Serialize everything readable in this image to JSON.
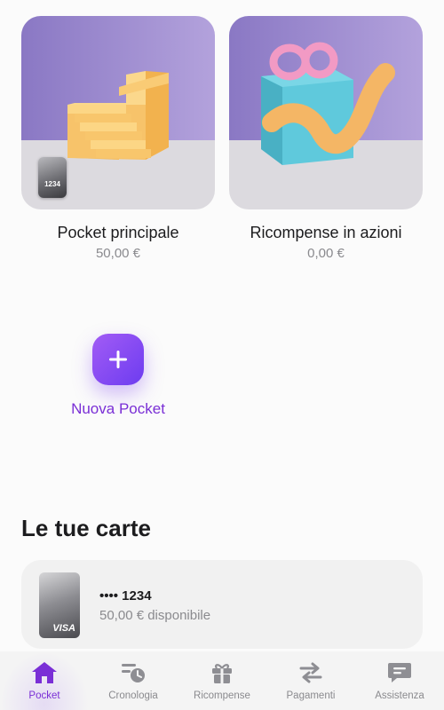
{
  "pockets": [
    {
      "name": "Pocket principale",
      "amount": "50,00 €",
      "card_last4": "1234"
    },
    {
      "name": "Ricompense in azioni",
      "amount": "0,00 €"
    }
  ],
  "new_pocket": {
    "label": "Nuova Pocket"
  },
  "cards_section": {
    "title": "Le tue carte",
    "card": {
      "number": "•••• 1234",
      "available": "50,00 € disponibile",
      "brand": "VISA"
    }
  },
  "tabs": [
    {
      "label": "Pocket",
      "icon": "home-icon",
      "active": true
    },
    {
      "label": "Cronologia",
      "icon": "history-icon",
      "active": false
    },
    {
      "label": "Ricompense",
      "icon": "gift-icon",
      "active": false
    },
    {
      "label": "Pagamenti",
      "icon": "transfer-arrows-icon",
      "active": false
    },
    {
      "label": "Assistenza",
      "icon": "chat-icon",
      "active": false
    }
  ],
  "colors": {
    "accent": "#7a2fd6",
    "background": "#fbfbfb",
    "card_background": "#f1f1f1",
    "muted_text": "#8a8a8e",
    "tab_icon_inactive": "#8e8e93"
  }
}
